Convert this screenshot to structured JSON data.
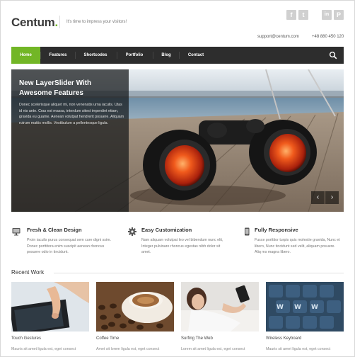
{
  "header": {
    "logo": "Centum",
    "logo_dot": ".",
    "tagline": "It's time to impress your visitors!",
    "email": "support@centum.com",
    "phone": "+48 880 450 120",
    "social": [
      {
        "icon": "facebook-icon",
        "glyph": "f"
      },
      {
        "icon": "twitter-icon",
        "glyph": "t"
      },
      {
        "icon": "linkedin-icon",
        "glyph": "in"
      },
      {
        "icon": "pinterest-icon",
        "glyph": "P"
      }
    ]
  },
  "nav": {
    "items": [
      "Home",
      "Features",
      "Shortcodes",
      "Portfolio",
      "Blog",
      "Contact"
    ],
    "active": "Home",
    "search_icon": "search-icon"
  },
  "slider": {
    "title": "New LayerSlider With Awesome Features",
    "text": "Donec scelerisque aliquet mi, non venenatis urna iaculis. Utas id nis ante. Cras est massa, interdum sitest imperdiet etiam, gravida eu guame. Aenean volutpat hendrerit posuere. Aliquam rutrum mattis mollis. Vestibulum a pellentesque ligula.",
    "prev_glyph": "‹",
    "next_glyph": "›"
  },
  "features": [
    {
      "icon": "monitor-icon",
      "title": "Fresh & Clean Design",
      "text": "Proin iaculis purus consequat sem cure digni ssim. Donec porttitora enim suscipit aenean rhoncus posuere odio in tincidunt."
    },
    {
      "icon": "gear-icon",
      "title": "Easy Customization",
      "text": "Nam aliquam volutpat leo vel bibendum nunc elit, Integer pulvinare rhoncus egestas nibh dolor sit amet."
    },
    {
      "icon": "mobile-icon",
      "title": "Fully Responsive",
      "text": "Fusce porttitor turpis quis molestie gravida, Nunc et libero, Nunc tincidunt sed velit, aliquam posuere. Aliq ms magna libero."
    }
  ],
  "recent": {
    "title": "Recent Work",
    "items": [
      {
        "title": "Touch Gestures",
        "text": "Mauris sit amet ligula est, eget consect"
      },
      {
        "title": "Coffee Time",
        "text": "Amet sit lorem ligula est, eget consect"
      },
      {
        "title": "Surfing The Web",
        "text": "Lorem sit amet ligula est, eget consect"
      },
      {
        "title": "Wireless Keyboard",
        "text": "Mauris sit amet ligula est, eget consect"
      }
    ]
  },
  "colors": {
    "accent": "#72b626",
    "nav_bg": "#2d2d2d"
  }
}
